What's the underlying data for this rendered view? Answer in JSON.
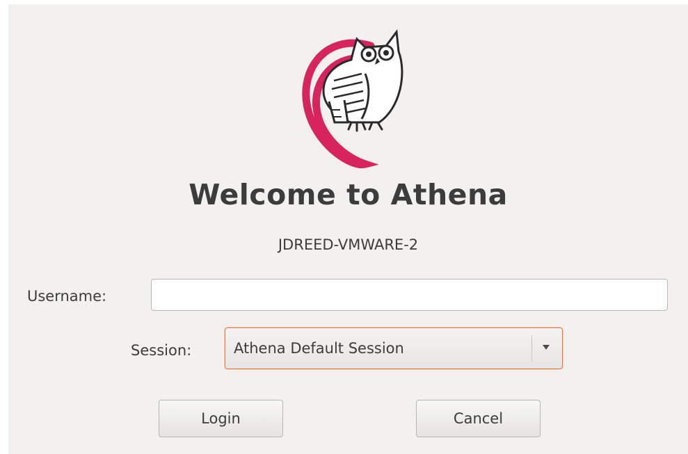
{
  "welcome": {
    "title": "Welcome to Athena",
    "hostname": "JDREED-VMWARE-2"
  },
  "logo": {
    "icon": "athena-owl-debian-swirl-logo",
    "swirl_color": "#d7245e"
  },
  "form": {
    "username_label": "Username:",
    "username_value": "",
    "session_label": "Session:",
    "session_value": "Athena Default Session"
  },
  "buttons": {
    "login": "Login",
    "cancel": "Cancel"
  },
  "colors": {
    "background": "#f2f1f0",
    "focus_border": "#e27b3a",
    "text": "#3c3c3c"
  }
}
